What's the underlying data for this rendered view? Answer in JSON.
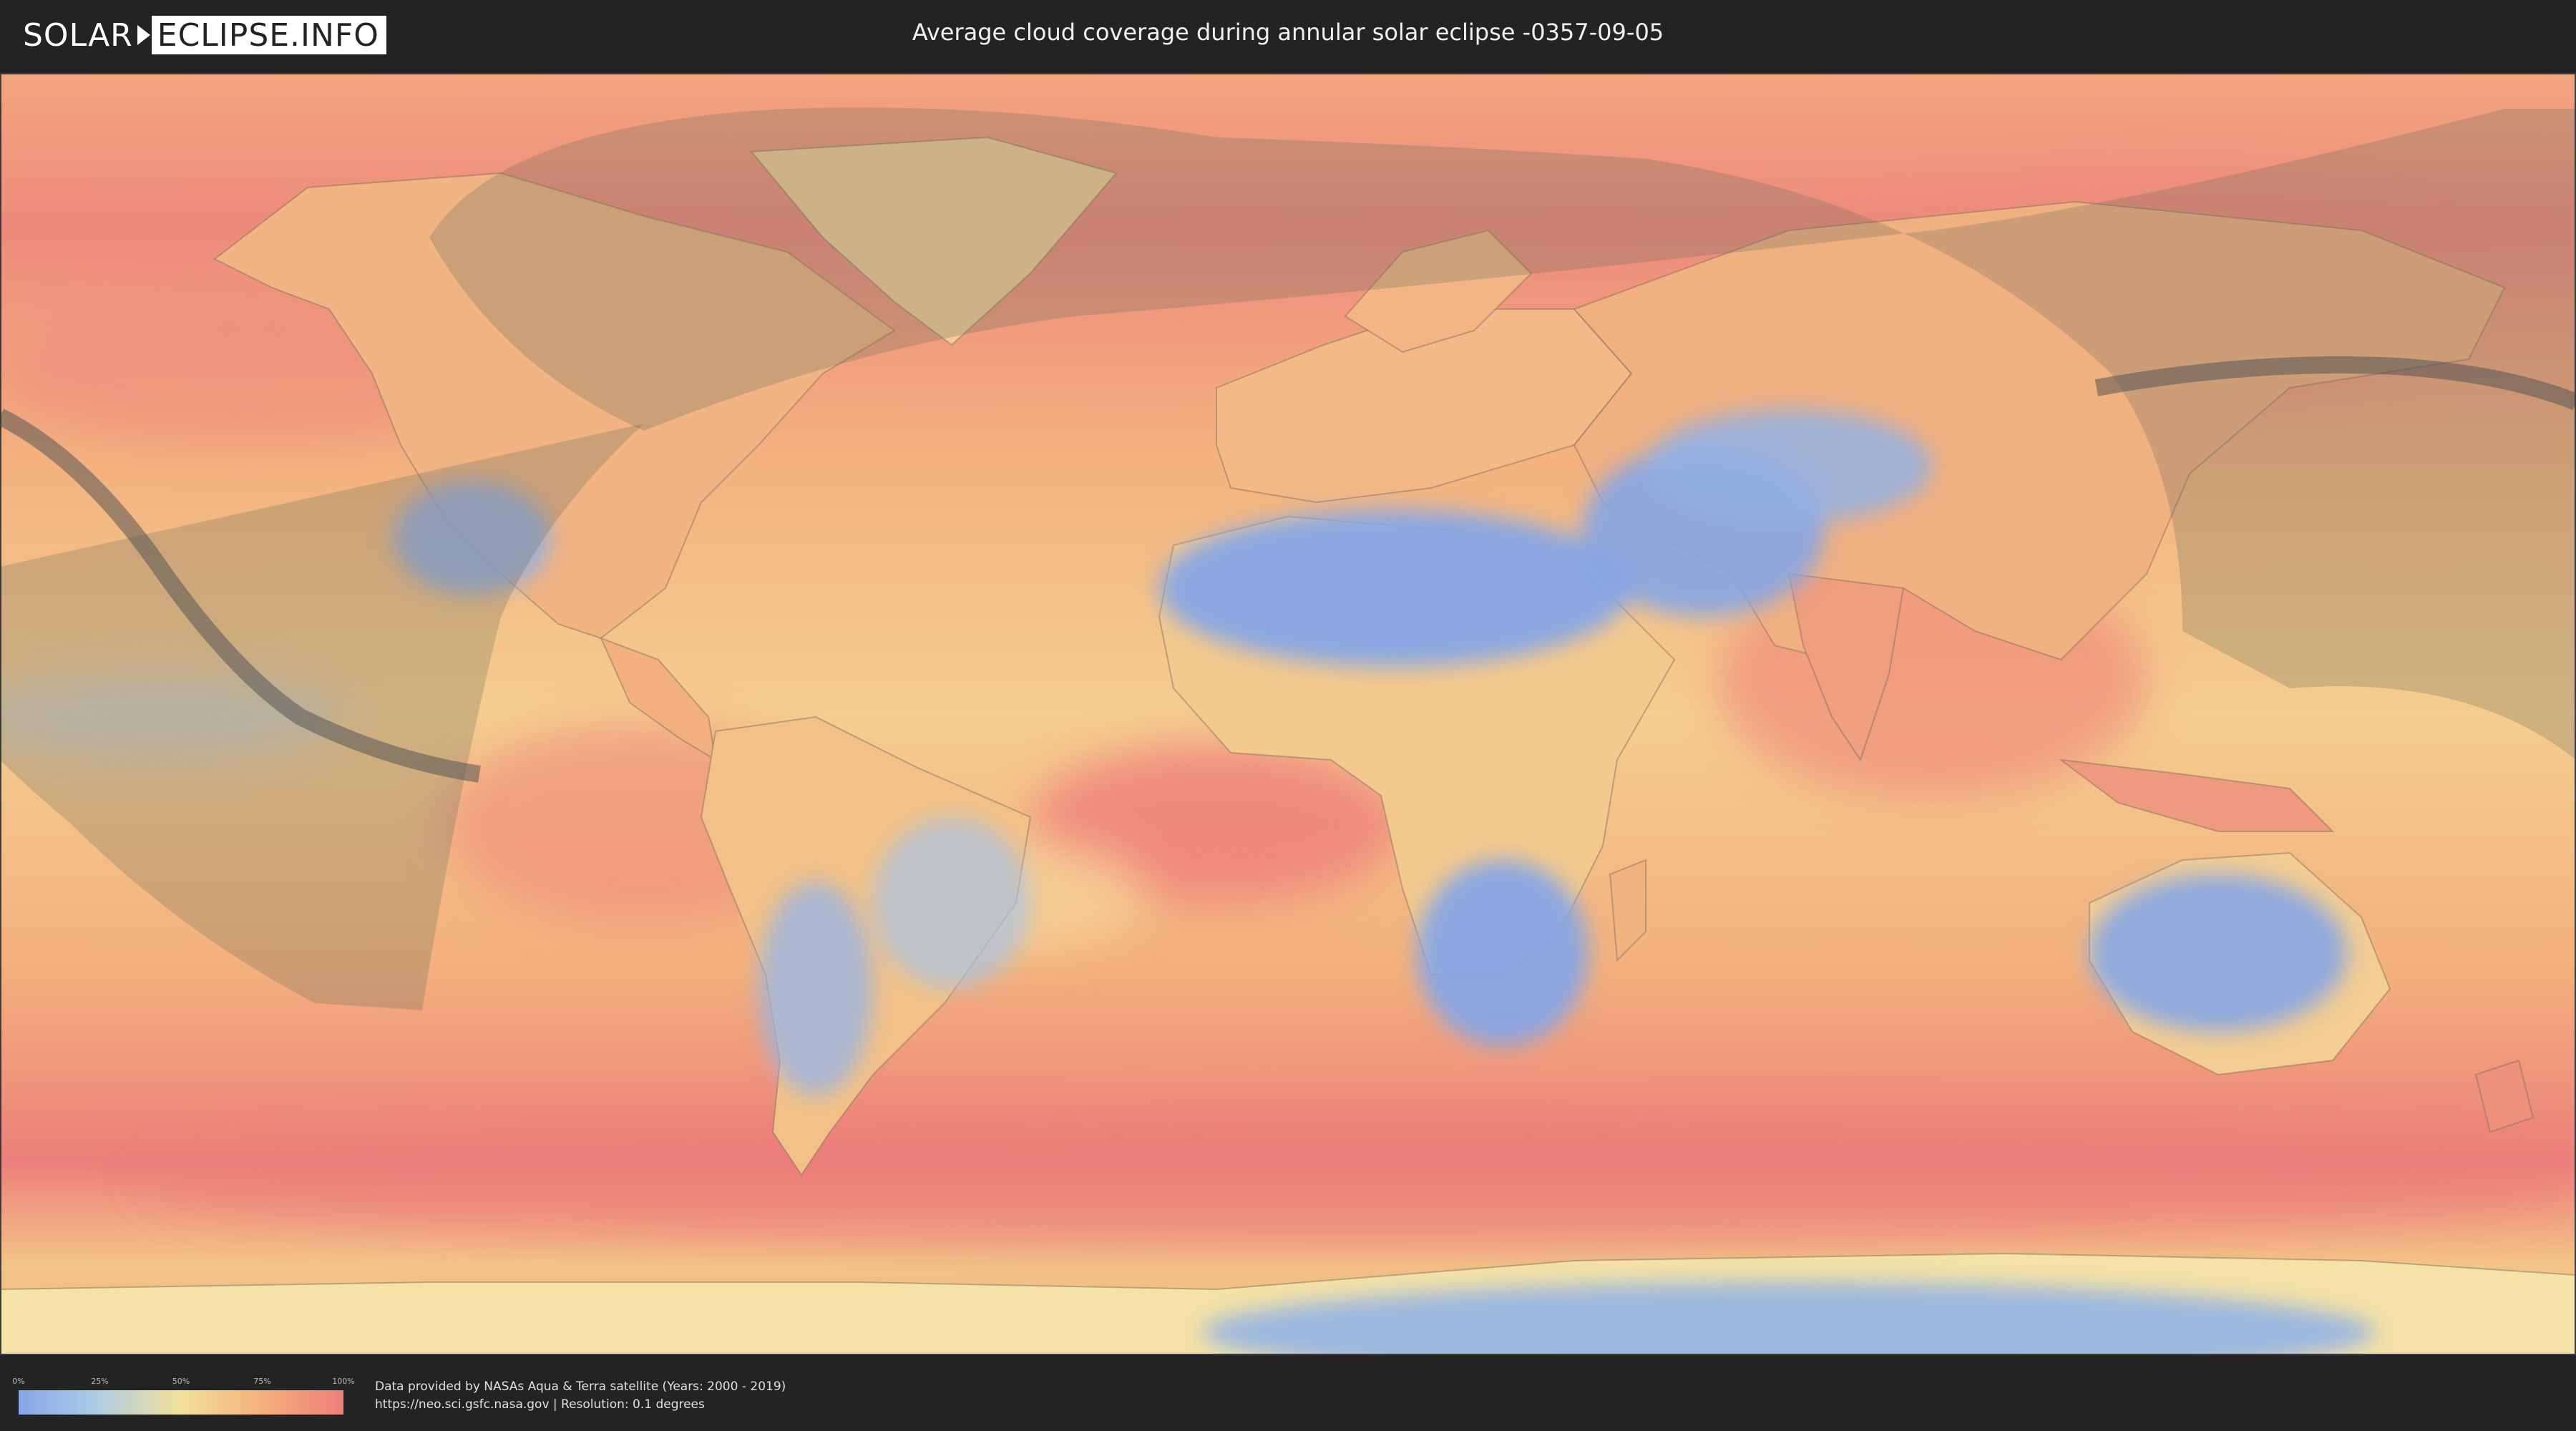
{
  "header": {
    "logo_left": "SOLAR",
    "logo_right": "ECLIPSE.INFO",
    "title": "Average cloud coverage during annular solar eclipse -0357-09-05"
  },
  "map": {
    "description_icon": "world-cloud-map",
    "colors": {
      "clear": "#86a5e6",
      "low": "#a9cbe8",
      "mid": "#f3e19c",
      "high": "#f4b07c",
      "overcast": "#ee7f7b",
      "eclipse_shade": "#6b6b5f",
      "path": "#555555"
    }
  },
  "legend": {
    "ticks": [
      "0%",
      "25%",
      "50%",
      "75%",
      "100%"
    ]
  },
  "footer": {
    "line1": "Data provided by NASAs Aqua & Terra satellite (Years: 2000 - 2019)",
    "line2": "https://neo.sci.gsfc.nasa.gov | Resolution: 0.1 degrees"
  }
}
